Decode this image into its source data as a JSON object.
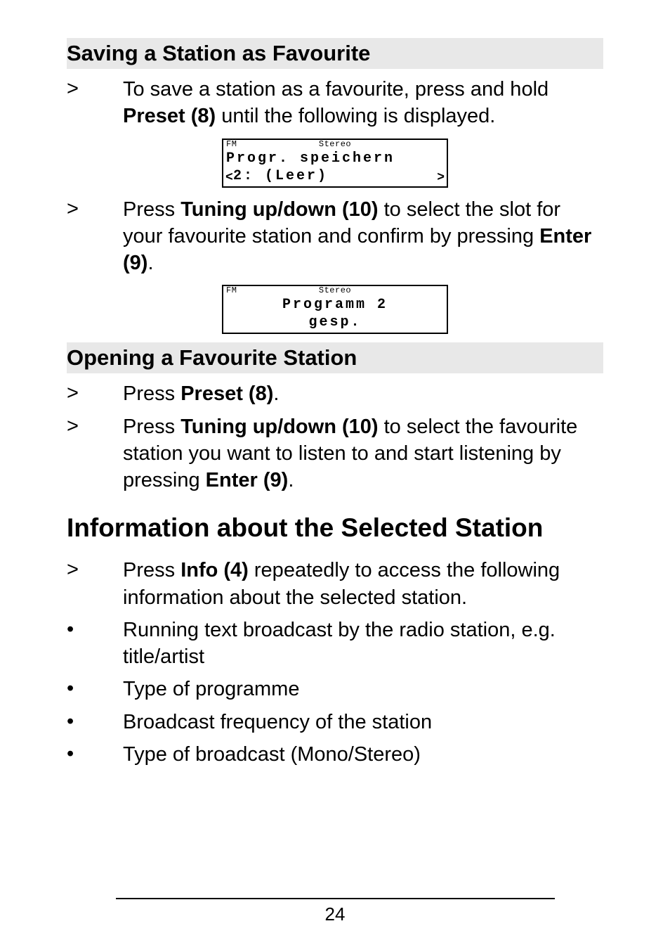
{
  "page_number": "24",
  "sections": {
    "save_fav": {
      "heading": "Saving a Station as Favourite",
      "step1_pre": "To save a station as a favourite, press and hold ",
      "step1_bold": "Preset (8)",
      "step1_post": " until the following is displayed.",
      "lcd1": {
        "top_left": "FM",
        "top_mid": "Stereo",
        "line1": "Progr. speichern",
        "line2_pre": "<",
        "line2": "2: (Leer)",
        "line2_post": ">"
      },
      "step2_pre": "Press ",
      "step2_bold": "Tuning up/down (10)",
      "step2_mid": " to select the slot for your favourite station and confirm by pressing ",
      "step2_bold2": "Enter (9)",
      "step2_post": ".",
      "lcd2": {
        "top_left": "FM",
        "top_mid": "Stereo",
        "line1": "Programm 2",
        "line2": "gesp."
      }
    },
    "open_fav": {
      "heading": "Opening a Favourite Station",
      "step1_pre": "Press ",
      "step1_bold": "Preset (8)",
      "step1_post": ".",
      "step2_pre": "Press ",
      "step2_bold": "Tuning up/down (10)",
      "step2_mid": " to select the favourite station you want to listen to and start listening by pressing ",
      "step2_bold2": "Enter (9)",
      "step2_post": "."
    },
    "info": {
      "heading": "Information about the Selected Station",
      "step1_pre": "Press ",
      "step1_bold": "Info (4)",
      "step1_post": " repeatedly to access the following information about the selected station.",
      "bullets": [
        "Running text broadcast by the radio station, e.g. title/artist",
        "Type of programme",
        "Broadcast frequency of the station",
        "Type of broadcast (Mono/Stereo)"
      ]
    }
  }
}
